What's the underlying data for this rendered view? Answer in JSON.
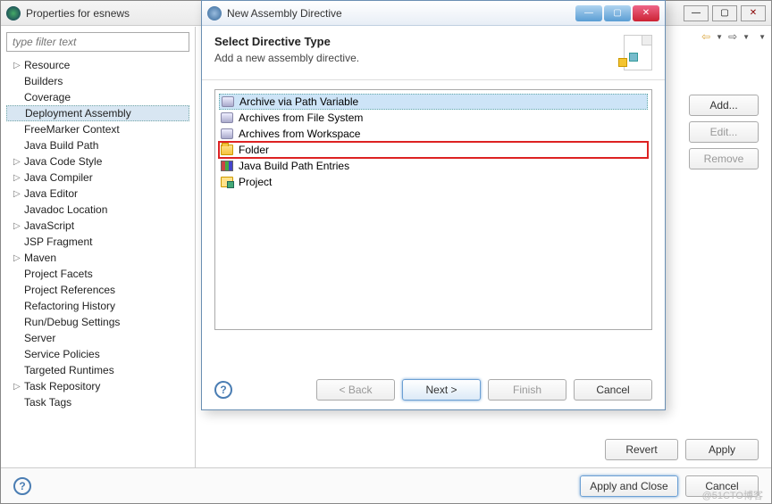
{
  "mainWindow": {
    "title": "Properties for esnews",
    "filterPlaceholder": "type filter text",
    "tree": [
      {
        "label": "Resource",
        "arrow": true
      },
      {
        "label": "Builders"
      },
      {
        "label": "Coverage"
      },
      {
        "label": "Deployment Assembly",
        "selected": true
      },
      {
        "label": "FreeMarker Context"
      },
      {
        "label": "Java Build Path"
      },
      {
        "label": "Java Code Style",
        "arrow": true
      },
      {
        "label": "Java Compiler",
        "arrow": true
      },
      {
        "label": "Java Editor",
        "arrow": true
      },
      {
        "label": "Javadoc Location"
      },
      {
        "label": "JavaScript",
        "arrow": true
      },
      {
        "label": "JSP Fragment"
      },
      {
        "label": "Maven",
        "arrow": true
      },
      {
        "label": "Project Facets"
      },
      {
        "label": "Project References"
      },
      {
        "label": "Refactoring History"
      },
      {
        "label": "Run/Debug Settings"
      },
      {
        "label": "Server"
      },
      {
        "label": "Service Policies"
      },
      {
        "label": "Targeted Runtimes"
      },
      {
        "label": "Task Repository",
        "arrow": true
      },
      {
        "label": "Task Tags"
      }
    ],
    "rightButtons": {
      "add": "Add...",
      "edit": "Edit...",
      "remove": "Remove"
    },
    "bottomButtons": {
      "revert": "Revert",
      "apply": "Apply"
    },
    "footer": {
      "applyClose": "Apply and Close",
      "cancel": "Cancel"
    },
    "nav": {
      "back": "⇦",
      "fwd": "⇨"
    }
  },
  "dialog": {
    "title": "New Assembly Directive",
    "heading": "Select Directive Type",
    "subtitle": "Add a new assembly directive.",
    "items": [
      {
        "label": "Archive via Path Variable",
        "icon": "jar",
        "selected": true
      },
      {
        "label": "Archives from File System",
        "icon": "jar"
      },
      {
        "label": "Archives from Workspace",
        "icon": "jar"
      },
      {
        "label": "Folder",
        "icon": "folder",
        "highlight": true
      },
      {
        "label": "Java Build Path Entries",
        "icon": "books"
      },
      {
        "label": "Project",
        "icon": "proj"
      }
    ],
    "buttons": {
      "back": "< Back",
      "next": "Next >",
      "finish": "Finish",
      "cancel": "Cancel"
    }
  },
  "watermark": "@51CTO博客"
}
